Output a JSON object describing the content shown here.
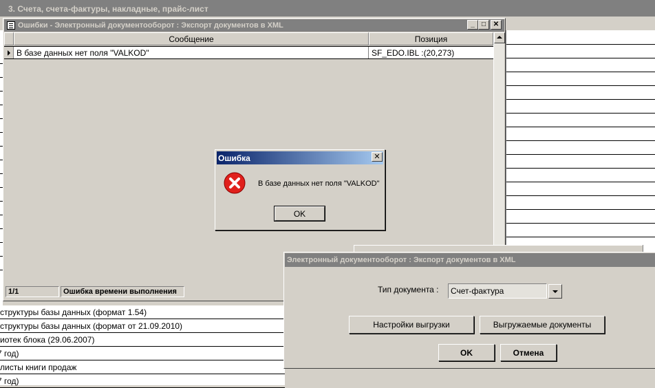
{
  "outer_window": {
    "title": "3. Счета, счета-фактуры, накладные, прайс-лист"
  },
  "bottom_list": {
    "rows": [
      "структуры базы данных (формат 1.54)",
      "структуры базы данных (формат от 21.09.2010)",
      "иотек блока (29.06.2007)",
      "7 год)",
      "листы книги продаж",
      "7 год)"
    ]
  },
  "errors_window": {
    "title": "Ошибки - Электронный документооборот : Экспорт документов в XML",
    "columns": [
      "Сообщение",
      "Позиция"
    ],
    "rows": [
      {
        "message": "В базе данных нет поля \"VALKOD\"",
        "position": "SF_EDO.IBL :(20,273)"
      }
    ],
    "status": {
      "record": "1/1",
      "kind": "Ошибка времени выполнения"
    },
    "buttons": {
      "minimize": "_",
      "maximize": "□",
      "close": "✕"
    }
  },
  "error_dialog": {
    "title": "Ошибка",
    "close": "✕",
    "icon": "error-icon",
    "message": "В базе данных нет поля \"VALKOD\"",
    "ok_label": "OK"
  },
  "export_window": {
    "title": "Электронный документооборот : Экспорт документов в XML",
    "doc_type_label": "Тип документа :",
    "doc_type_value": "Счет-фактура",
    "settings_button": "Настройки выгрузки",
    "docs_button": "Выгружаемые документы",
    "ok_label": "OK",
    "cancel_label": "Отмена"
  },
  "colors": {
    "window_face": "#d4d0c8",
    "inactive_title": "#808080",
    "active_title_start": "#0a246a",
    "active_title_end": "#a6caf0",
    "error_red": "#e0201c"
  }
}
